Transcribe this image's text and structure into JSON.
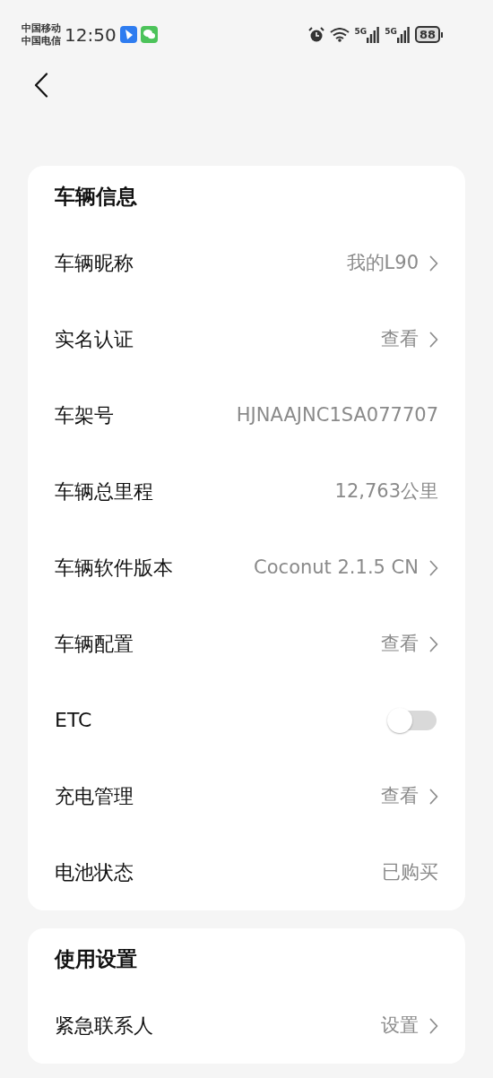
{
  "status_bar": {
    "carriers": [
      "中国移动",
      "中国电信"
    ],
    "time": "12:50",
    "network_labels": [
      "5G",
      "5G"
    ],
    "battery": "88"
  },
  "sections": [
    {
      "title": "车辆信息",
      "rows": [
        {
          "kind": "link",
          "label": "车辆昵称",
          "value": "我的L90"
        },
        {
          "kind": "link",
          "label": "实名认证",
          "value": "查看"
        },
        {
          "kind": "value",
          "label": "车架号",
          "value": "HJNAAJNC1SA077707"
        },
        {
          "kind": "value",
          "label": "车辆总里程",
          "value": "12,763公里"
        },
        {
          "kind": "link",
          "label": "车辆软件版本",
          "value": "Coconut 2.1.5 CN"
        },
        {
          "kind": "link",
          "label": "车辆配置",
          "value": "查看"
        },
        {
          "kind": "toggle",
          "label": "ETC",
          "on": false
        },
        {
          "kind": "link",
          "label": "充电管理",
          "value": "查看"
        },
        {
          "kind": "value",
          "label": "电池状态",
          "value": "已购买"
        }
      ]
    },
    {
      "title": "使用设置",
      "rows": [
        {
          "kind": "link",
          "label": "紧急联系人",
          "value": "设置"
        }
      ]
    }
  ]
}
